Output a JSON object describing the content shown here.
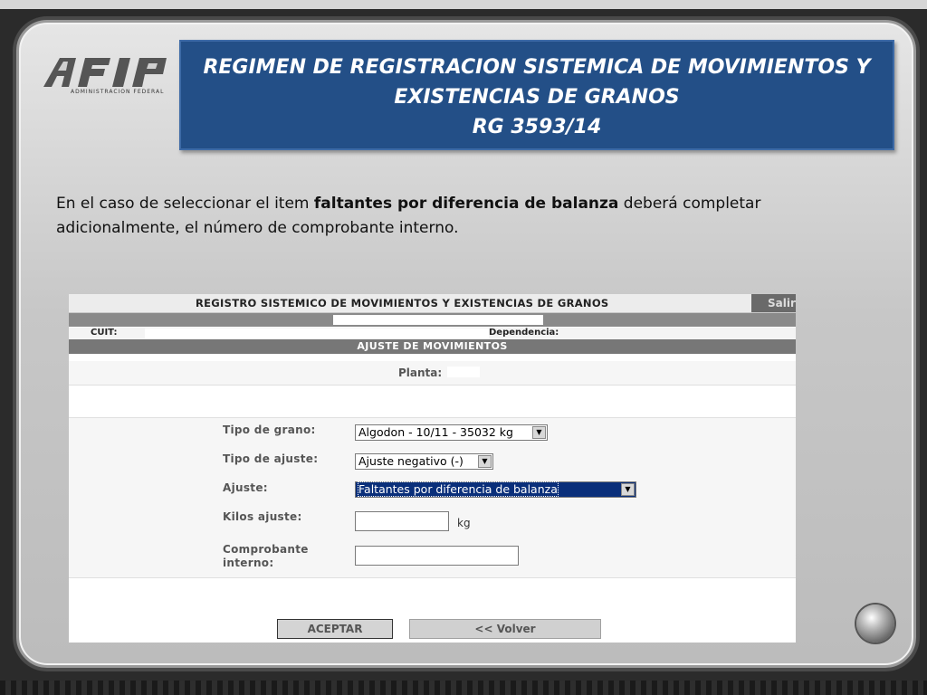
{
  "slide": {
    "logo_text": "AFIP",
    "logo_subtext": "ADMINISTRACION FEDERAL",
    "title_lines": [
      "REGIMEN DE REGISTRACION SISTEMICA DE MOVIMIENTOS Y",
      "EXISTENCIAS DE GRANOS",
      "RG  3593/14"
    ],
    "body": {
      "part1": "En el caso de seleccionar el item ",
      "bold": "faltantes por diferencia de balanza",
      "part2": " deberá completar adicionalmente, el número de comprobante interno."
    }
  },
  "app": {
    "header_title": "REGISTRO SISTEMICO DE MOVIMIENTOS Y EXISTENCIAS DE GRANOS",
    "salir_label": "Salir",
    "cuit_label": "CUIT:",
    "dependencia_label": "Dependencia:",
    "section_title": "AJUSTE DE MOVIMIENTOS",
    "planta_label": "Planta:",
    "form": {
      "tipo_grano_label": "Tipo de grano:",
      "tipo_grano_value": "Algodon - 10/11 - 35032 kg",
      "tipo_ajuste_label": "Tipo de ajuste:",
      "tipo_ajuste_value": "Ajuste negativo (-)",
      "ajuste_label": "Ajuste:",
      "ajuste_value": "Faltantes por diferencia de balanza",
      "kilos_label": "Kilos ajuste:",
      "kilos_value": "",
      "kilos_unit": "kg",
      "comprobante_label_line1": "Comprobante",
      "comprobante_label_line2": "interno:",
      "comprobante_value": ""
    },
    "buttons": {
      "accept": "ACEPTAR",
      "back": "<< Volver"
    }
  },
  "colors": {
    "title_bg": "#234f87",
    "selected_option_bg": "#0a2f7a",
    "section_bar": "#777777"
  }
}
